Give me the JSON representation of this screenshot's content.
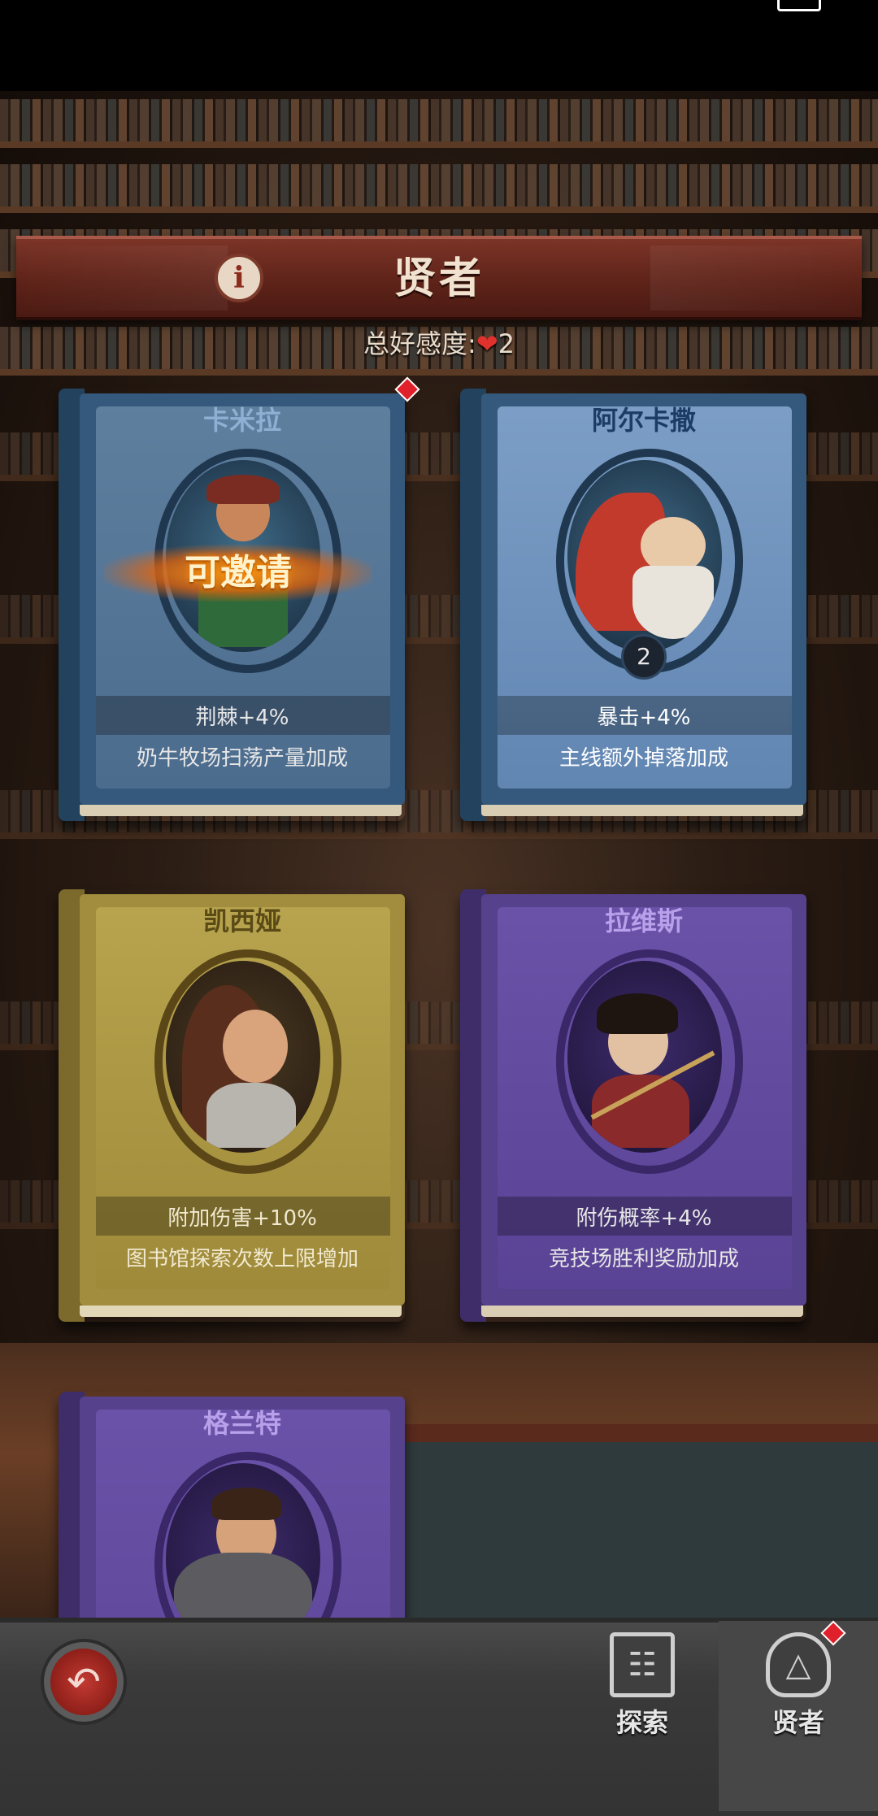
{
  "status_bar": {
    "text": ""
  },
  "header": {
    "title": "贤者",
    "info_icon": "info-icon",
    "total_favor_label": "总好感度:",
    "total_favor_value": "2"
  },
  "cards": [
    {
      "name": "卡米拉",
      "stat": "荆棘+4%",
      "desc": "奶牛牧场扫荡产量加成",
      "theme": "blue",
      "badge": "可邀请",
      "has_new_dot": true
    },
    {
      "name": "阿尔卡撒",
      "stat": "暴击+4%",
      "desc": "主线额外掉落加成",
      "theme": "blue",
      "level": "2"
    },
    {
      "name": "凯西娅",
      "stat": "附加伤害+10%",
      "desc": "图书馆探索次数上限增加",
      "theme": "gold"
    },
    {
      "name": "拉维斯",
      "stat": "附伤概率+4%",
      "desc": "竞技场胜利奖励加成",
      "theme": "purple"
    },
    {
      "name": "格兰特",
      "theme": "purple"
    }
  ],
  "bottom_nav": {
    "back_icon": "back-arrow-icon",
    "tabs": [
      {
        "label": "探索",
        "icon": "bookshelf-icon"
      },
      {
        "label": "贤者",
        "icon": "sage-hood-icon",
        "has_new_dot": true,
        "selected": true
      }
    ]
  },
  "colors": {
    "banner": "#5e2319",
    "blue_card": "#35597c",
    "gold_card": "#a18d3d",
    "purple_card": "#55418c",
    "badge_red": "#e0202a"
  }
}
